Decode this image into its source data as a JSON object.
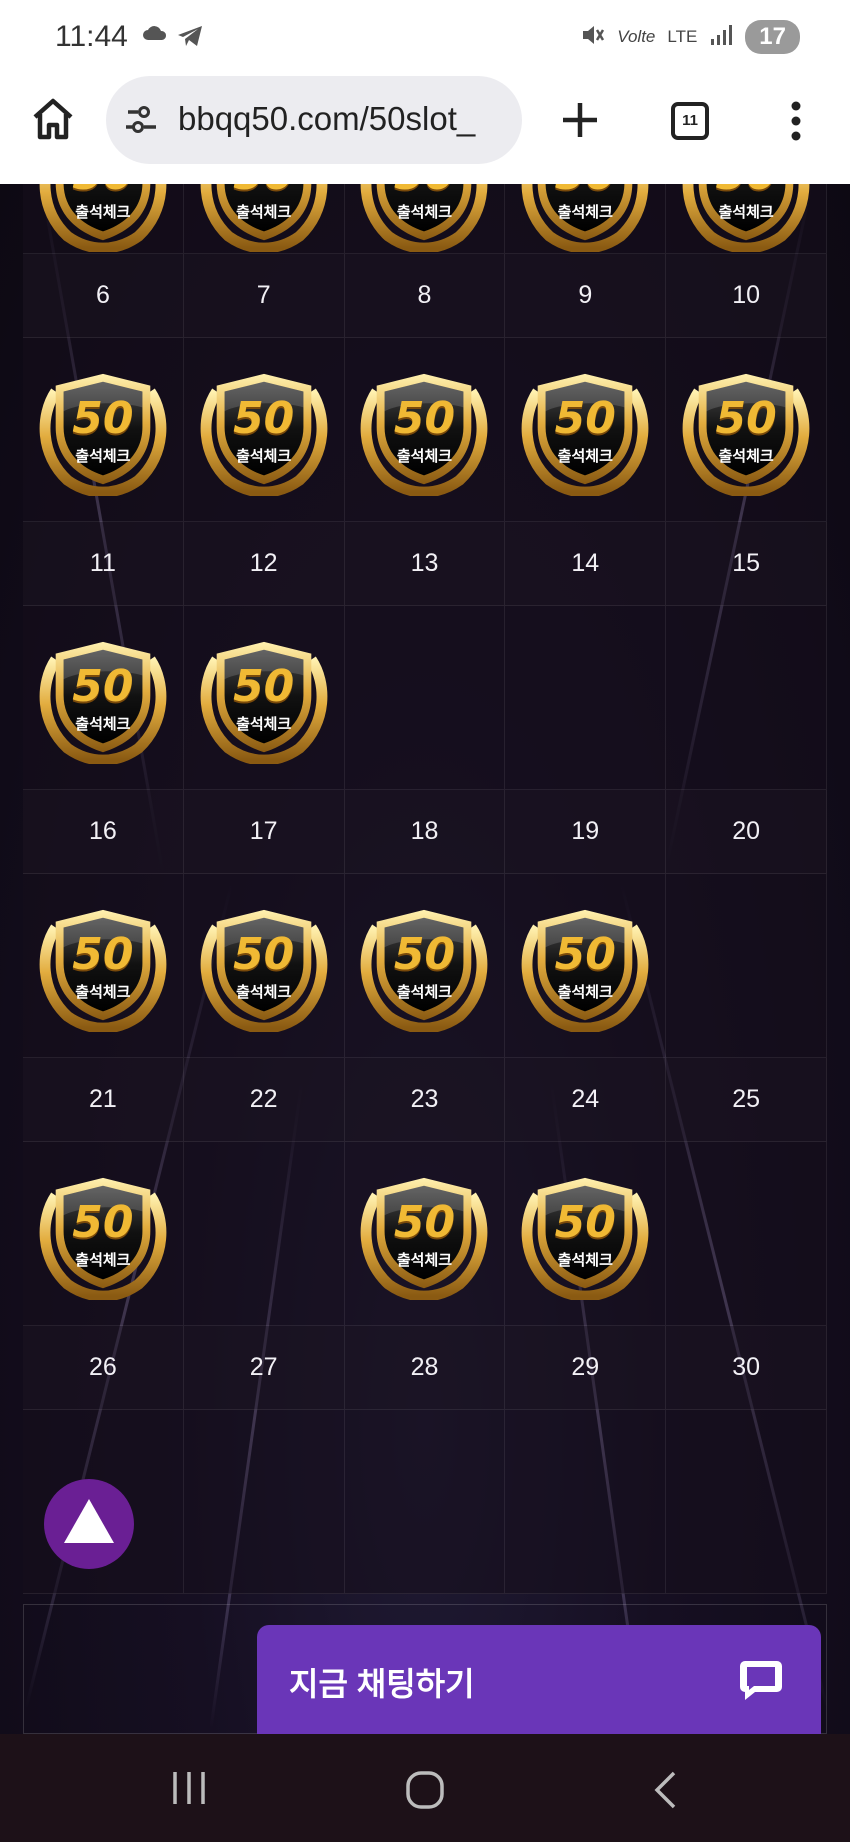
{
  "status_bar": {
    "time": "11:44",
    "lte_label": "LTE",
    "volte_label": "Volte",
    "battery": "17"
  },
  "browser": {
    "url": "bbqq50.com/50slot_",
    "tab_count": "11"
  },
  "calendar": {
    "stamp_label": "출석체크",
    "stamp_number": "50",
    "partial_top_row": [
      true,
      true,
      true,
      true,
      true
    ],
    "weeks": [
      {
        "dates": [
          "6",
          "7",
          "8",
          "9",
          "10"
        ],
        "stamped": [
          true,
          true,
          true,
          true,
          true
        ]
      },
      {
        "dates": [
          "11",
          "12",
          "13",
          "14",
          "15"
        ],
        "stamped": [
          true,
          true,
          false,
          false,
          false
        ]
      },
      {
        "dates": [
          "16",
          "17",
          "18",
          "19",
          "20"
        ],
        "stamped": [
          true,
          true,
          true,
          true,
          false
        ]
      },
      {
        "dates": [
          "21",
          "22",
          "23",
          "24",
          "25"
        ],
        "stamped": [
          true,
          false,
          true,
          true,
          false
        ]
      },
      {
        "dates": [
          "26",
          "27",
          "28",
          "29",
          "30"
        ],
        "stamped": [
          false,
          false,
          false,
          false,
          false
        ]
      }
    ]
  },
  "chat": {
    "label": "지금 채팅하기"
  },
  "colors": {
    "chat_button": "#6a36b8",
    "scroll_top_button": "#6a1f94",
    "badge_gold": "#d9a441"
  }
}
